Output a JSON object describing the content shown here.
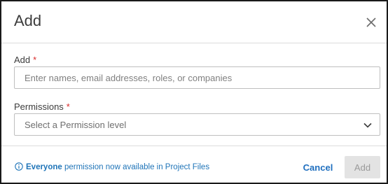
{
  "dialog": {
    "title": "Add",
    "close_icon": "close-icon"
  },
  "form": {
    "add_field": {
      "label": "Add",
      "required_marker": "*",
      "placeholder": "Enter names, email addresses, roles, or companies",
      "value": ""
    },
    "permissions_field": {
      "label": "Permissions",
      "required_marker": "*",
      "selected": "Select a Permission level",
      "icon": "chevron-down-icon"
    }
  },
  "footer": {
    "info_icon": "info-icon",
    "info_bold": "Everyone",
    "info_text": " permission now available in Project Files",
    "cancel_label": "Cancel",
    "add_label": "Add"
  },
  "colors": {
    "link": "#1f74b8",
    "required": "#d92b2b",
    "disabled_bg": "#e3e3e3",
    "disabled_text": "#9a9a9a"
  }
}
